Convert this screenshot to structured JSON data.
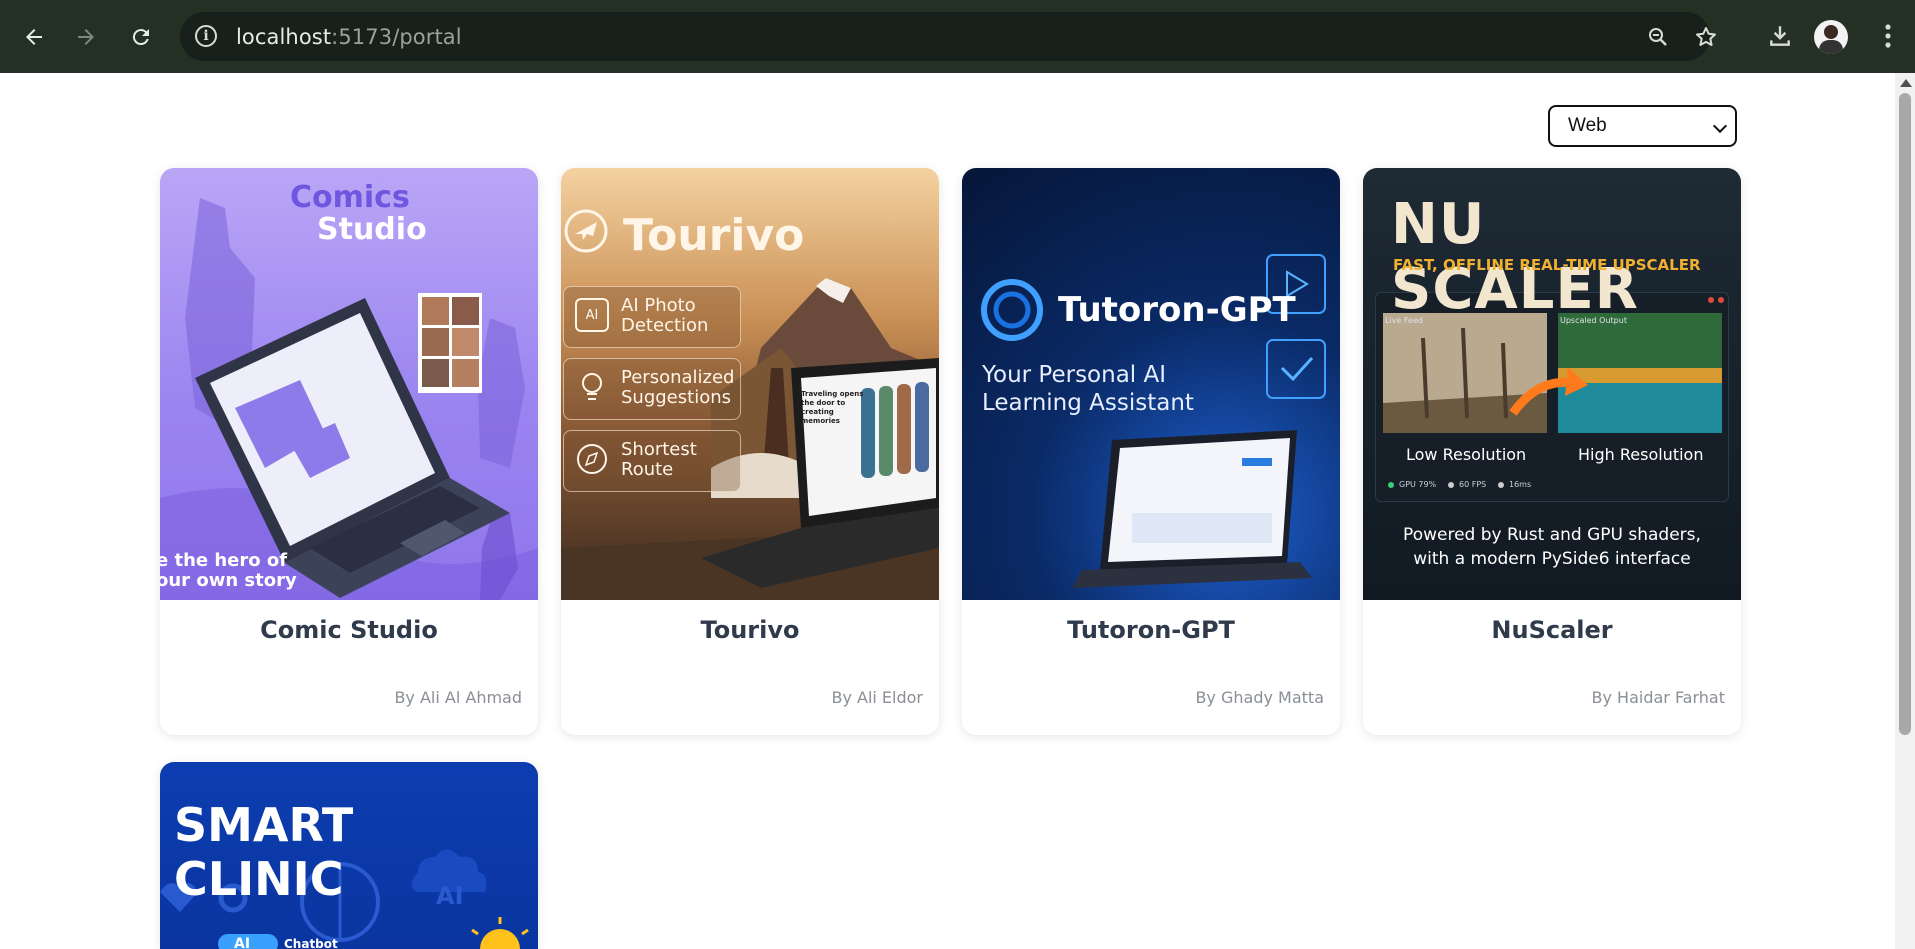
{
  "browser": {
    "url_host": "localhost",
    "url_rest": ":5173/portal"
  },
  "icons": [
    "back-arrow-icon",
    "forward-arrow-icon",
    "reload-icon",
    "info-icon",
    "zoom-icon",
    "star-icon",
    "download-icon",
    "profile-avatar",
    "kebab-menu-icon"
  ],
  "filter": {
    "selected": "Web"
  },
  "projects": [
    {
      "title": "Comic Studio",
      "author": "By Ali Al Ahmad",
      "thumb_heading_1": "Comics",
      "thumb_heading_2": "Studio",
      "thumb_tagline_1": "e the hero of",
      "thumb_tagline_2": "our own story"
    },
    {
      "title": "Tourivo",
      "author": "By Ali Eldor",
      "thumb_heading": "Tourivo",
      "features": [
        "AI Photo\nDetection",
        "Personalized\nSuggestions",
        "Shortest\nRoute"
      ],
      "screen_headline": "Traveling opens the door to creating memories"
    },
    {
      "title": "Tutoron-GPT",
      "author": "By Ghady Matta",
      "thumb_heading": "Tutoron-GPT",
      "thumb_subtitle_1": "Your Personal AI",
      "thumb_subtitle_2": "Learning Assistant"
    },
    {
      "title": "NuScaler",
      "author": "By Haidar Farhat",
      "thumb_heading": "NU SCALER",
      "thumb_subheading": "FAST, OFFLINE REAL-TIME UPSCALER",
      "label_live": "Live Feed",
      "label_upscaled": "Upscaled Output",
      "label_low": "Low Resolution",
      "label_high": "High Resolution",
      "stat_gpu": "GPU 79%",
      "stat_fps": "60 FPS",
      "stat_ms": "16ms",
      "footer_1": "Powered by Rust and GPU shaders,",
      "footer_2": "with a modern PySide6 interface"
    },
    {
      "thumb_heading": "SMART CLINIC",
      "ai_badge": "AI",
      "chatbot_label": "Chatbot",
      "chatbot_ai": "AI"
    }
  ],
  "colors": {
    "chrome_bg": "#233023",
    "card_title": "#2f3b4b",
    "author": "#8a8f96",
    "comic_purple": "#9a84f0",
    "tutoron_blue": "#0a2a66",
    "clinic_blue": "#0a3aa8"
  }
}
